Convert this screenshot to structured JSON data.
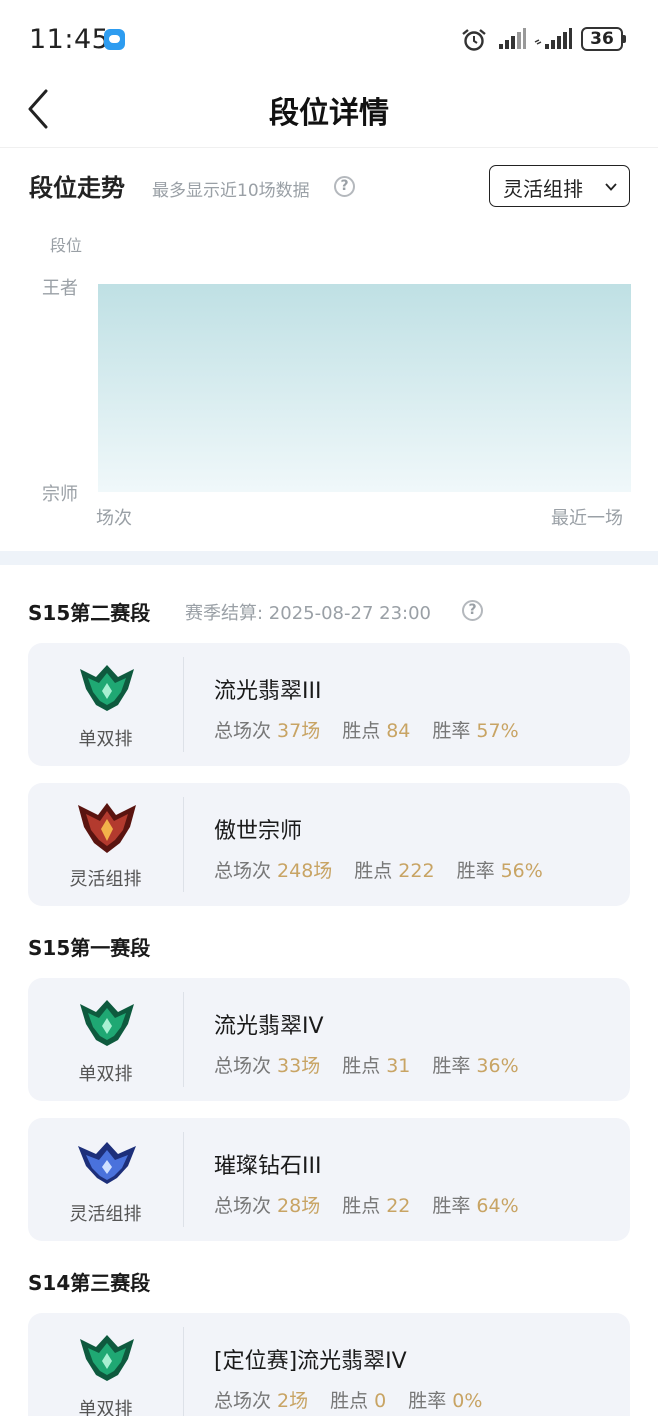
{
  "status_bar": {
    "time": "11:45",
    "battery": "36"
  },
  "nav": {
    "title": "段位详情"
  },
  "trend": {
    "title": "段位走势",
    "subtitle": "最多显示近10场数据",
    "help": "?",
    "dropdown_label": "灵活组排"
  },
  "chart_data": {
    "type": "area",
    "ylabel": "段位",
    "y_ticks": [
      "王者",
      "宗师"
    ],
    "x_labels": [
      "场次",
      "最近一场"
    ],
    "fill_top_color": "#bfe0e4",
    "fill_bottom_color": "#f0f8fa",
    "series": [
      {
        "values": [
          "王者",
          "王者"
        ]
      }
    ]
  },
  "seasons": [
    {
      "name": "S15第二赛段",
      "note": "赛季结算: 2025-08-27 23:00",
      "help": "?",
      "cards": [
        {
          "queue": "单双排",
          "emblem": "emerald-emblem-icon",
          "rank": "流光翡翠III",
          "games_label": "总场次",
          "games": "37场",
          "points_label": "胜点",
          "points": "84",
          "winrate_label": "胜率",
          "winrate": "57%"
        },
        {
          "queue": "灵活组排",
          "emblem": "grandmaster-emblem-icon",
          "rank": "傲世宗师",
          "games_label": "总场次",
          "games": "248场",
          "points_label": "胜点",
          "points": "222",
          "winrate_label": "胜率",
          "winrate": "56%"
        }
      ]
    },
    {
      "name": "S15第一赛段",
      "cards": [
        {
          "queue": "单双排",
          "emblem": "emerald-emblem-icon",
          "rank": "流光翡翠IV",
          "games_label": "总场次",
          "games": "33场",
          "points_label": "胜点",
          "points": "31",
          "winrate_label": "胜率",
          "winrate": "36%"
        },
        {
          "queue": "灵活组排",
          "emblem": "diamond-emblem-icon",
          "rank": "璀璨钻石III",
          "games_label": "总场次",
          "games": "28场",
          "points_label": "胜点",
          "points": "22",
          "winrate_label": "胜率",
          "winrate": "64%"
        }
      ]
    },
    {
      "name": "S14第三赛段",
      "cards": [
        {
          "queue": "单双排",
          "emblem": "emerald-emblem-icon",
          "rank": "[定位赛]流光翡翠IV",
          "games_label": "总场次",
          "games": "2场",
          "points_label": "胜点",
          "points": "0",
          "winrate_label": "胜率",
          "winrate": "0%"
        }
      ]
    }
  ],
  "colors": {
    "value_gold": "#c8a464",
    "card_bg": "#f2f4f9",
    "emerald": "#1f9a6a",
    "grandmaster": "#b33a2e",
    "diamond": "#3b5fc4"
  }
}
